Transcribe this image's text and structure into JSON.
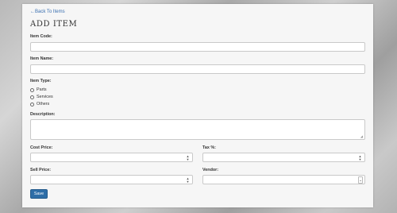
{
  "nav": {
    "back_label": "←Back To Items"
  },
  "page": {
    "title": "ADD ITEM"
  },
  "fields": {
    "item_code": {
      "label": "Item Code:",
      "value": ""
    },
    "item_name": {
      "label": "Item Name:",
      "value": ""
    },
    "item_type": {
      "label": "Item Type:",
      "options": [
        "Parts",
        "Services",
        "Others"
      ]
    },
    "description": {
      "label": "Description:",
      "value": ""
    },
    "cost_price": {
      "label": "Cost Price:",
      "value": ""
    },
    "tax": {
      "label": "Tax %:",
      "value": ""
    },
    "sell_price": {
      "label": "Sell Price:",
      "value": ""
    },
    "vendor": {
      "label": "Vendor:",
      "value": ""
    }
  },
  "actions": {
    "save_label": "Save"
  },
  "icons": {
    "spinner": "number-spinner-icon",
    "dropdown": "chevron-down-icon"
  }
}
